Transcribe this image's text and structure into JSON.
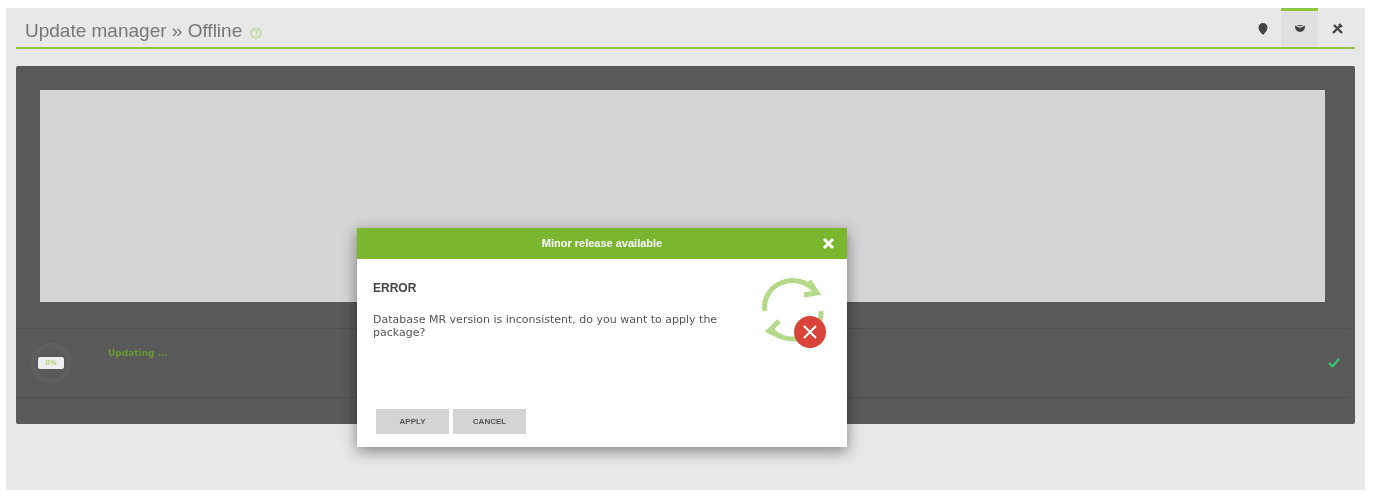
{
  "header": {
    "title": "Update manager » Offline"
  },
  "tabs": [
    {
      "kind": "pin",
      "selected": false
    },
    {
      "kind": "package",
      "selected": true
    },
    {
      "kind": "tools",
      "selected": false
    }
  ],
  "progress": {
    "reading": "0%",
    "status": "Updating ...",
    "done": true
  },
  "dialog": {
    "title": "Minor release available",
    "heading": "ERROR",
    "message": "Database MR version is inconsistent, do you want to apply the package?",
    "buttons": [
      {
        "label": "APPLY"
      },
      {
        "label": "CANCEL"
      }
    ]
  }
}
